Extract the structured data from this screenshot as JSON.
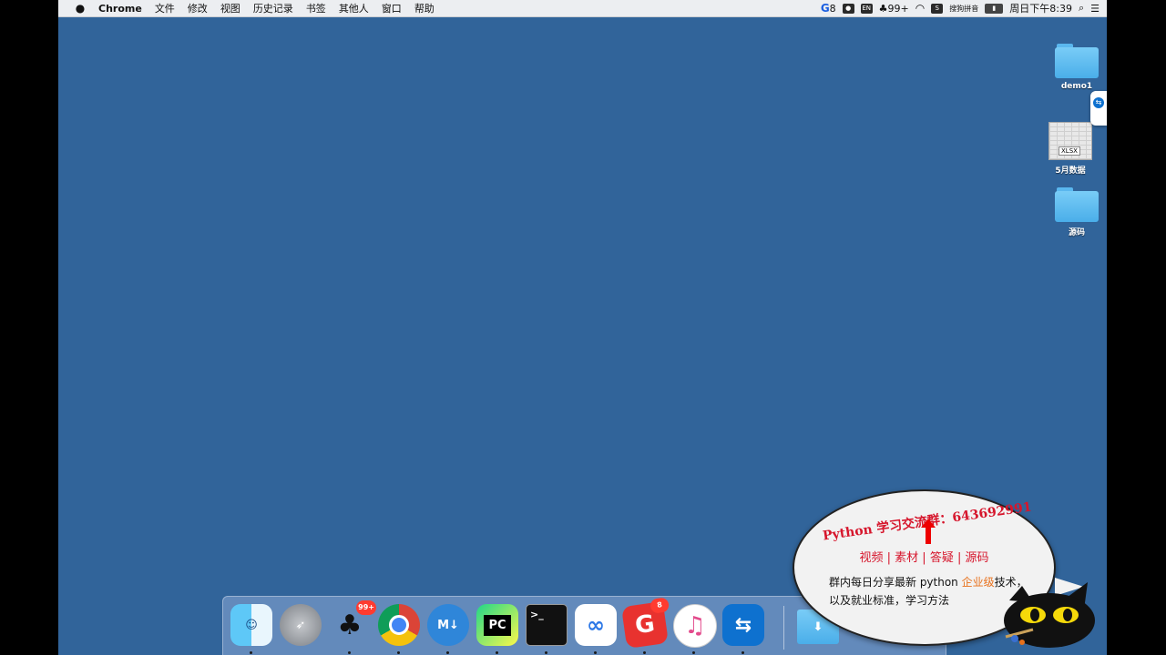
{
  "menubar": {
    "app_name": "Chrome",
    "menus": [
      "文件",
      "修改",
      "视图",
      "历史记录",
      "书签",
      "其他人",
      "窗口",
      "帮助"
    ],
    "status": {
      "g_count": "8",
      "qq_count": "99+",
      "input_method": "搜狗拼音",
      "clock": "周日下午8:39"
    }
  },
  "desktop": {
    "items": [
      {
        "label": "demo1",
        "type": "folder"
      },
      {
        "label": "5月数据",
        "type": "xlsx",
        "badge": "XLSX"
      },
      {
        "label": "源码",
        "type": "folder"
      }
    ]
  },
  "dock": {
    "apps": [
      {
        "name": "Finder",
        "icon": "finder-icon"
      },
      {
        "name": "Launchpad",
        "icon": "rocket-icon"
      },
      {
        "name": "QQ",
        "icon": "penguin-icon",
        "badge": "99+"
      },
      {
        "name": "Chrome",
        "icon": "chrome-icon"
      },
      {
        "name": "MWeb",
        "icon": "markdown-icon",
        "text": "M↓"
      },
      {
        "name": "PyCharm",
        "icon": "pycharm-icon",
        "text": "PC"
      },
      {
        "name": "Terminal",
        "icon": "terminal-icon",
        "text": ">_"
      },
      {
        "name": "Baidu Netdisk",
        "icon": "cloud-icon"
      },
      {
        "name": "G",
        "icon": "g-app-icon",
        "badge": "8"
      },
      {
        "name": "iTunes",
        "icon": "music-icon",
        "text": "♫"
      },
      {
        "name": "TeamViewer",
        "icon": "teamviewer-icon"
      }
    ]
  },
  "ad_bubble": {
    "headline": "Python 学习交流群：643692991",
    "tags": "视频 | 素材 | 答疑 | 源码",
    "desc_prefix": "群内每日分享最新 python ",
    "desc_highlight": "企业级",
    "desc_suffix": "技术，",
    "desc_line2": "以及就业标准，学习方法"
  },
  "colors": {
    "desktop": "#31649a",
    "accent_red": "#d6162c",
    "highlight_orange": "#e8711c"
  }
}
